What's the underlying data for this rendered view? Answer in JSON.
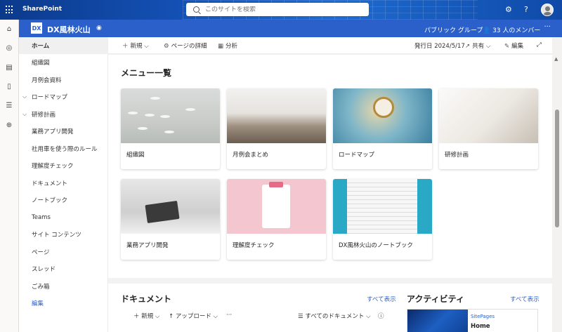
{
  "suitebar": {
    "brand": "SharePoint",
    "search_placeholder": "このサイトを検索",
    "icons": [
      "waffle-icon",
      "gear-icon",
      "help-icon",
      "avatar"
    ]
  },
  "site": {
    "logo": "DX",
    "title": "DX風林火山",
    "group_label": "パブリック グループ",
    "members": "33 人のメンバー",
    "more": "···"
  },
  "nav": {
    "items": [
      {
        "label": "ホーム",
        "active": true
      },
      {
        "label": "組織図"
      },
      {
        "label": "月例会資料"
      },
      {
        "label": "ロードマップ",
        "expandable": true
      },
      {
        "label": "研修計画",
        "expandable": true
      },
      {
        "label": "業務アプリ開発"
      },
      {
        "label": "社用車を使う際のルール"
      },
      {
        "label": "理解度チェック"
      },
      {
        "label": "ドキュメント"
      },
      {
        "label": "ノートブック"
      },
      {
        "label": "Teams"
      },
      {
        "label": "サイト コンテンツ"
      },
      {
        "label": "ページ"
      },
      {
        "label": "スレッド"
      },
      {
        "label": "ごみ箱"
      },
      {
        "label": "編集",
        "link": true
      }
    ]
  },
  "commandbar": {
    "new": "新規",
    "page_details": "ページの詳細",
    "analytics": "分析",
    "published": "発行日 2024/5/17",
    "share": "共有",
    "edit": "編集"
  },
  "menu": {
    "title": "メニュー一覧",
    "tiles": [
      {
        "label": "組織図"
      },
      {
        "label": "月例会まとめ"
      },
      {
        "label": "ロードマップ"
      },
      {
        "label": "研修計画"
      },
      {
        "label": "業務アプリ開発"
      },
      {
        "label": "理解度チェック"
      },
      {
        "label": "DX風林火山のノートブック"
      }
    ]
  },
  "documents": {
    "title": "ドキュメント",
    "see_all": "すべて表示",
    "new": "新規",
    "upload": "アップロード",
    "more": "···",
    "view": "すべてのドキュメント"
  },
  "activity": {
    "title": "アクティビティ",
    "see_all": "すべて表示",
    "card_kind": "SitePages",
    "card_name": "Home"
  }
}
